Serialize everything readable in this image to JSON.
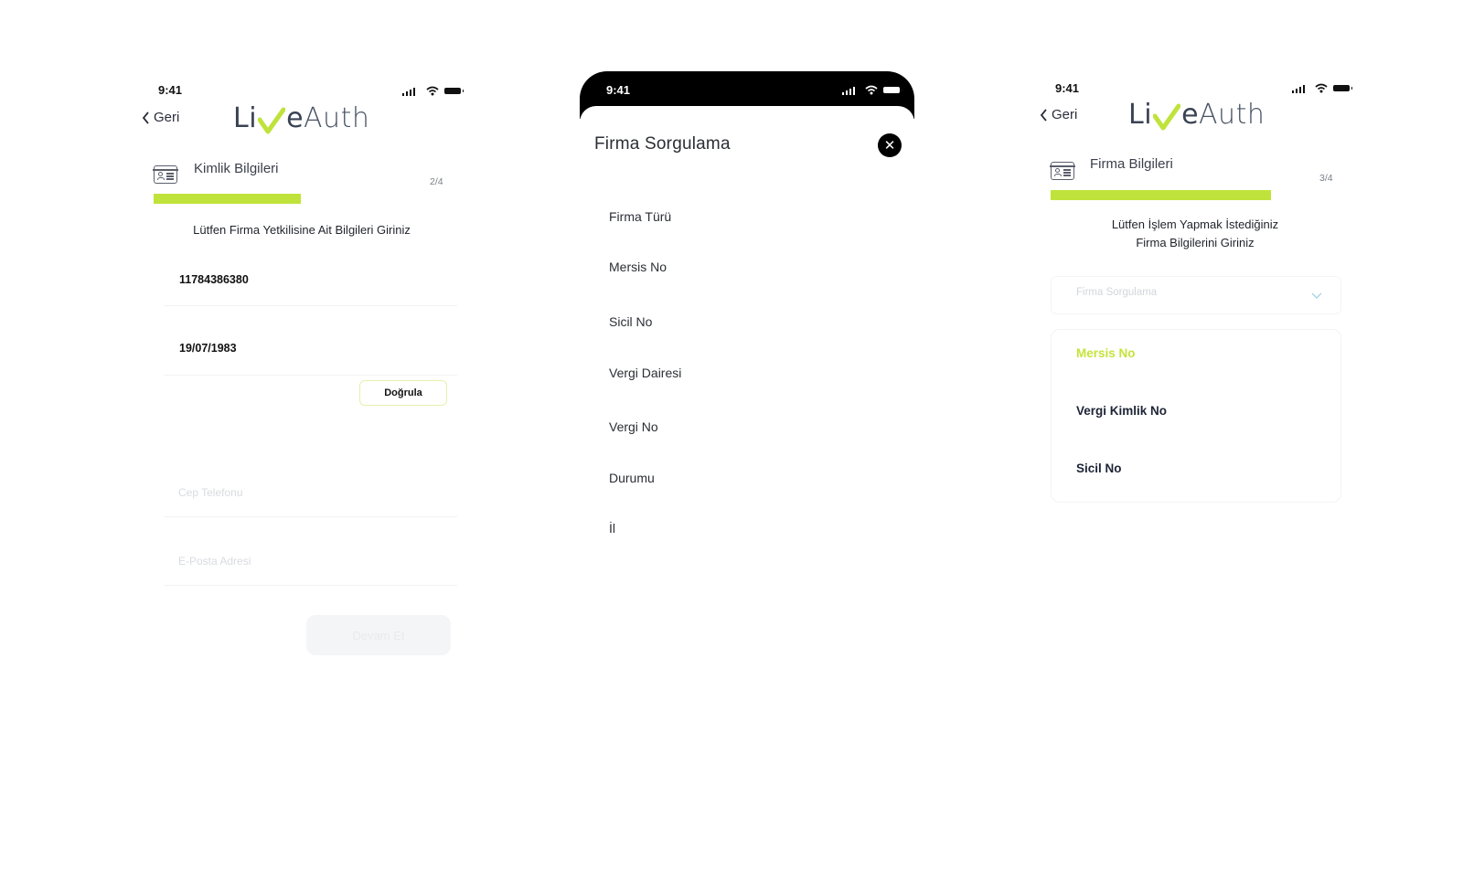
{
  "screen_left": {
    "status_time": "9:41",
    "back_label": "Geri",
    "logo": {
      "text_left": "Li",
      "text_e": "e",
      "text_auth": "Auth"
    },
    "section_title": "Kimlik Bilgileri",
    "step": "2/4",
    "progress_fraction": 0.5,
    "instruction": "Lütfen Firma Yetkilisine Ait Bilgileri Giriniz",
    "fields": {
      "tc_value": "11784386380",
      "birthdate_value": "19/07/1983",
      "phone_placeholder": "Cep Telefonu",
      "email_placeholder": "E-Posta Adresi"
    },
    "verify_label": "Doğrula",
    "submit_label": "Devam Et"
  },
  "screen_middle": {
    "status_time": "9:41",
    "title": "Firma Sorgulama",
    "close_icon": "close-icon",
    "items": [
      "Firma Türü",
      "Mersis No",
      "Sicil No",
      "Vergi Dairesi",
      "Vergi No",
      "Durumu",
      "İl"
    ]
  },
  "screen_right": {
    "status_time": "9:41",
    "back_label": "Geri",
    "logo": {
      "text_left": "Li",
      "text_e": "e",
      "text_auth": "Auth"
    },
    "section_title": "Firma Bilgileri",
    "step": "3/4",
    "progress_fraction": 0.75,
    "instruction_line1": "Lütfen İşlem Yapmak İstediğiniz",
    "instruction_line2": "Firma Bilgilerini Giriniz",
    "dropdown_placeholder": "Firma Sorgulama",
    "options": [
      "Mersis No",
      "Vergi Kimlik No",
      "Sicil No"
    ],
    "selected_option": "Mersis No"
  },
  "colors": {
    "accent": "#bfe33a",
    "accent_text": "#c4e43c",
    "text_dark": "#1d2436",
    "modal_header": "#000000"
  }
}
